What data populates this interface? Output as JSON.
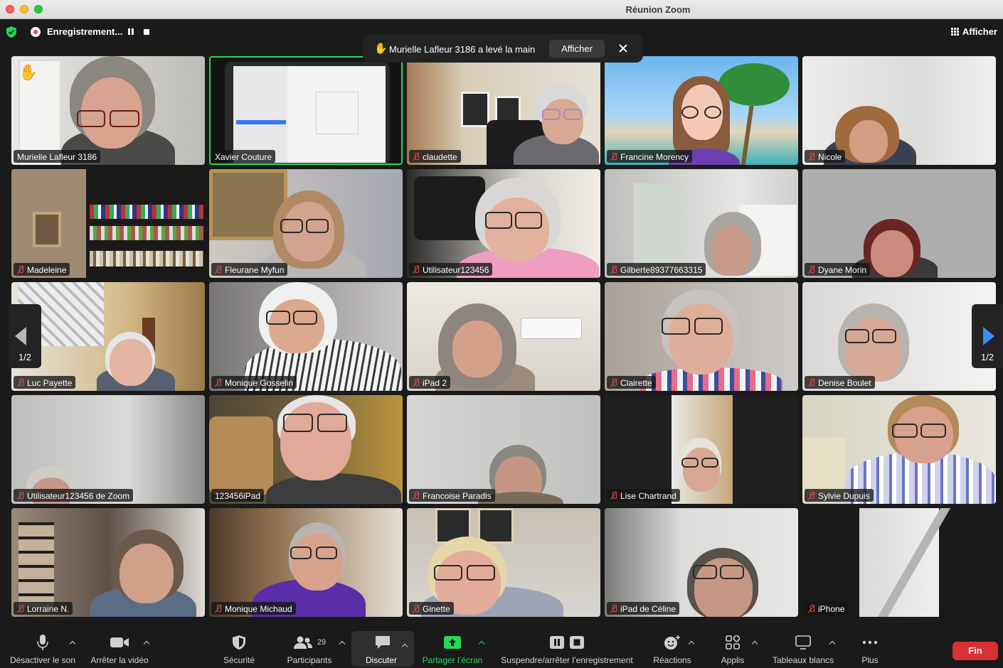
{
  "window": {
    "title": "Réunion Zoom"
  },
  "topbar": {
    "recording_label": "Enregistrement...",
    "view_label": "Afficher"
  },
  "notification": {
    "text": "Murielle Lafleur 3186 a levé la main",
    "button": "Afficher"
  },
  "pager": {
    "left": "1/2",
    "right": "1/2"
  },
  "participants": [
    {
      "name": "Murielle Lafleur 3186",
      "muted": false,
      "hand_raised": true
    },
    {
      "name": "Xavier Couture",
      "muted": false,
      "active_speaker": true
    },
    {
      "name": "claudette",
      "muted": true
    },
    {
      "name": "Francine Morency",
      "muted": true
    },
    {
      "name": "Nicole",
      "muted": true
    },
    {
      "name": "Madeleine",
      "muted": true
    },
    {
      "name": "Fleurane Myfun",
      "muted": true
    },
    {
      "name": "Utilisateur123456",
      "muted": true
    },
    {
      "name": "Gilberte89377663315",
      "muted": true
    },
    {
      "name": "Dyane Morin",
      "muted": true
    },
    {
      "name": "Luc Payette",
      "muted": true
    },
    {
      "name": "Monique Gosselin",
      "muted": true
    },
    {
      "name": "iPad 2",
      "muted": true
    },
    {
      "name": "Clairette",
      "muted": true
    },
    {
      "name": "Denise Boulet",
      "muted": true
    },
    {
      "name": "Utilisateur123456 de Zoom",
      "muted": true
    },
    {
      "name": "123456iPad",
      "muted": false
    },
    {
      "name": "Francoise Paradis",
      "muted": true
    },
    {
      "name": "Lise Chartrand",
      "muted": true
    },
    {
      "name": "Sylvie Dupuis",
      "muted": true
    },
    {
      "name": "Lorraine N.",
      "muted": true
    },
    {
      "name": "Monique Michaud",
      "muted": true
    },
    {
      "name": "Ginette",
      "muted": true
    },
    {
      "name": "iPad de Céline",
      "muted": true
    },
    {
      "name": "iPhone",
      "muted": true
    }
  ],
  "toolbar": {
    "mute_label": "Désactiver le son",
    "video_label": "Arrêter la vidéo",
    "security_label": "Sécurité",
    "participants_label": "Participants",
    "participants_count": "29",
    "chat_label": "Discuter",
    "share_label": "Partager l’écran",
    "record_label": "Suspendre/arrêter l’enregistrement",
    "reactions_label": "Réactions",
    "apps_label": "Applis",
    "whiteboards_label": "Tableaux blancs",
    "more_label": "Plus",
    "end_label": "Fin"
  },
  "colors": {
    "active_speaker_border": "#23d959",
    "end_button": "#d93136",
    "share_green": "#23d959",
    "pager_arrow": "#3b8cff"
  }
}
